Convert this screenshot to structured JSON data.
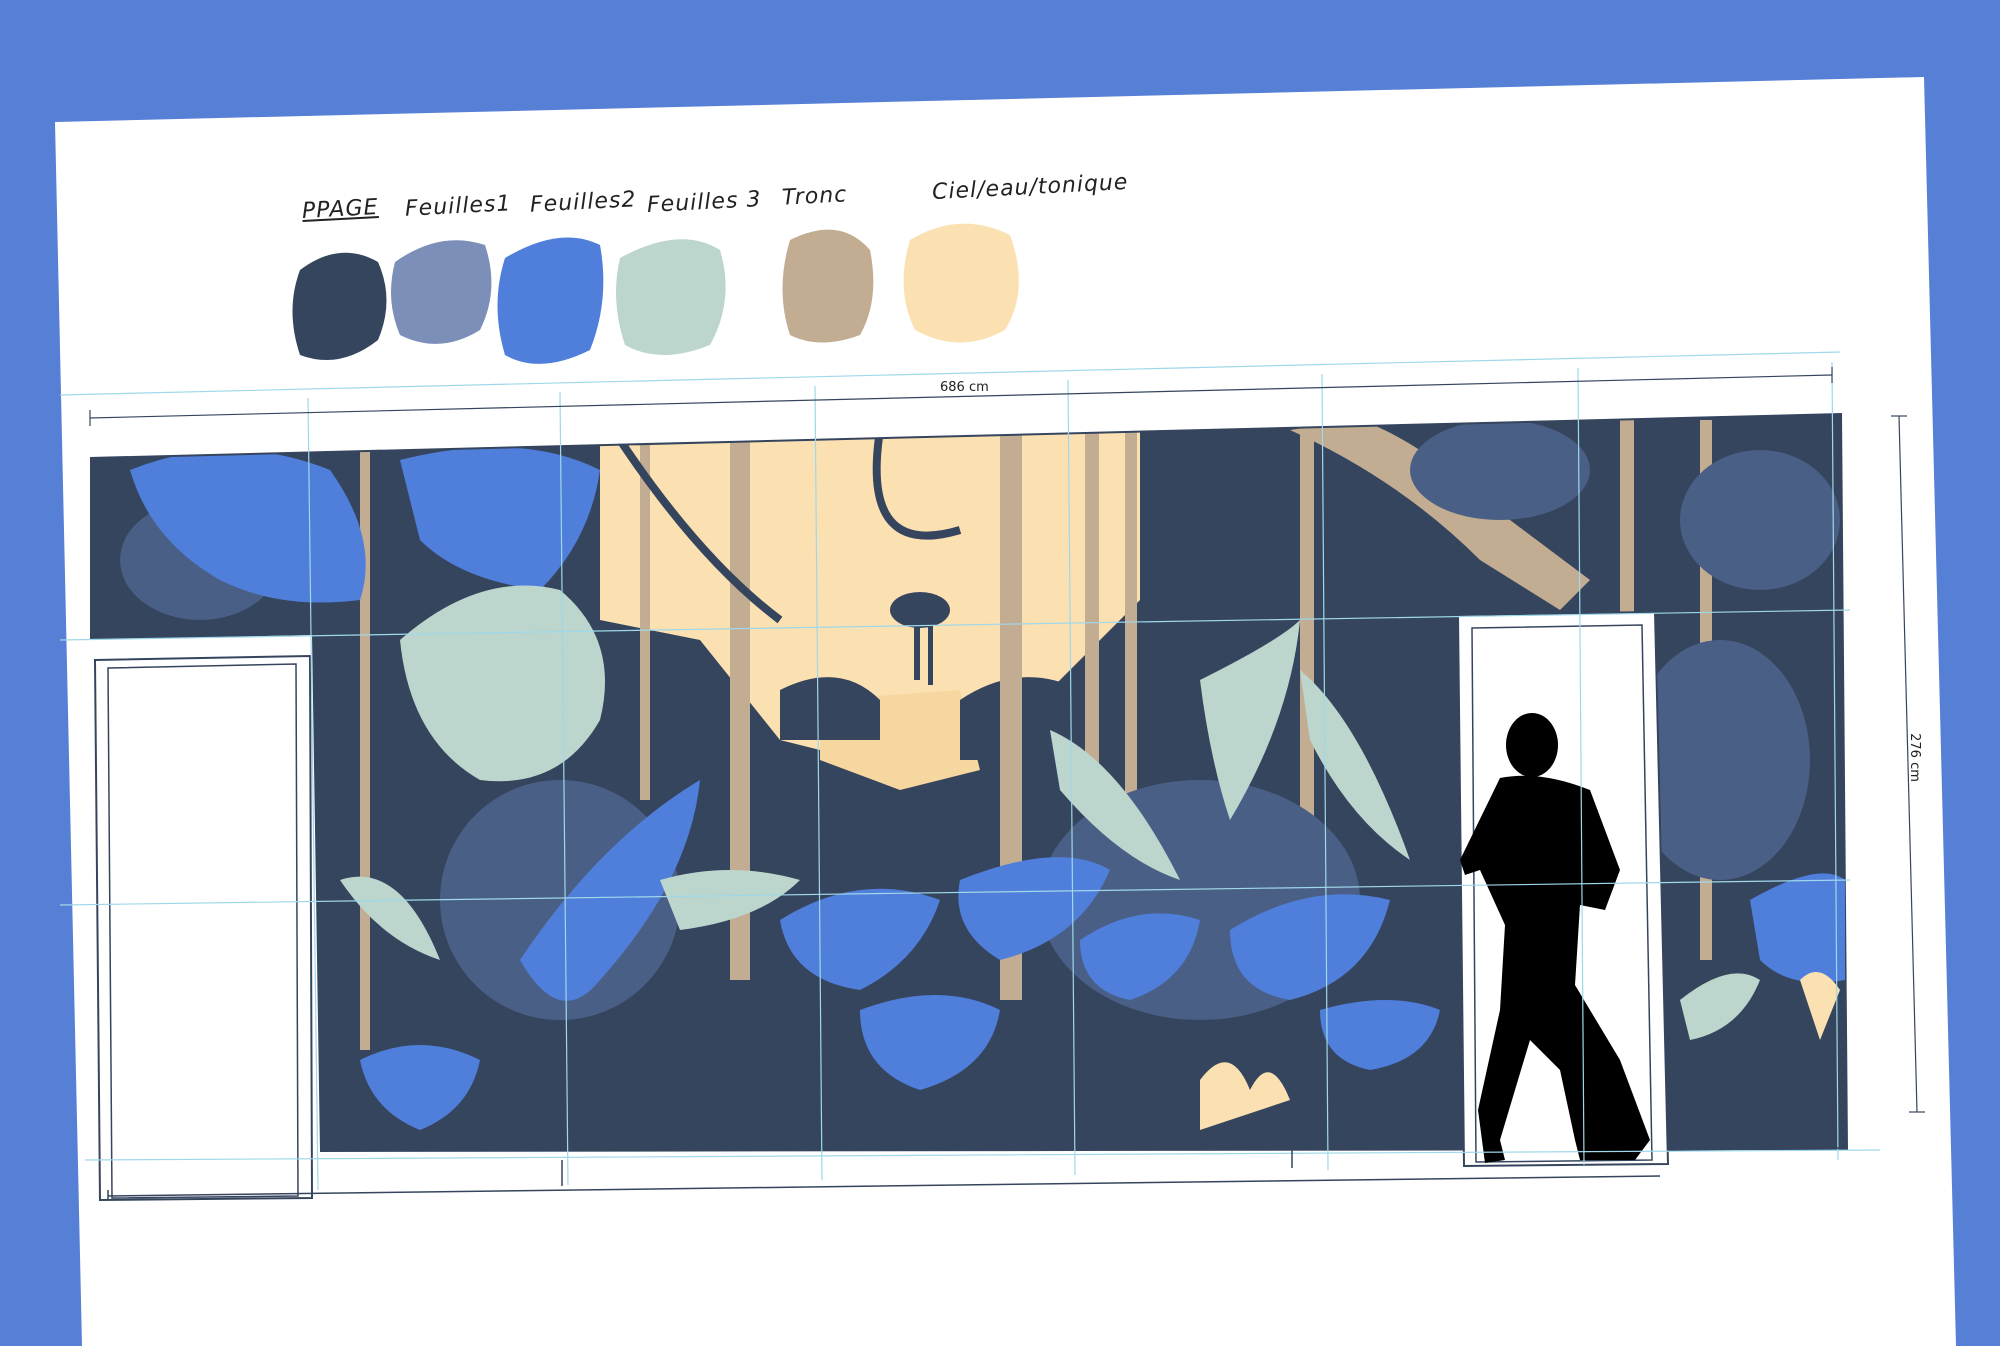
{
  "palette": {
    "swatches": [
      {
        "label": "PPAGE",
        "color": "#36455e"
      },
      {
        "label": "Feuilles1",
        "color": "#7b8fb8"
      },
      {
        "label": "Feuilles2",
        "color": "#4f7fdb"
      },
      {
        "label": "Feuilles 3",
        "color": "#bcd6cd"
      },
      {
        "label": "Tronc",
        "color": "#c2ad92"
      },
      {
        "label": "Ciel/eau/tonique",
        "color": "#fbe1b2"
      }
    ]
  },
  "dimensions": {
    "width_label": "686 cm",
    "height_label": "276 cm"
  },
  "colors": {
    "background": "#567fd6",
    "paper": "#ffffff",
    "forest_dark": "#36455e",
    "guide_line": "#9fd8ea"
  }
}
